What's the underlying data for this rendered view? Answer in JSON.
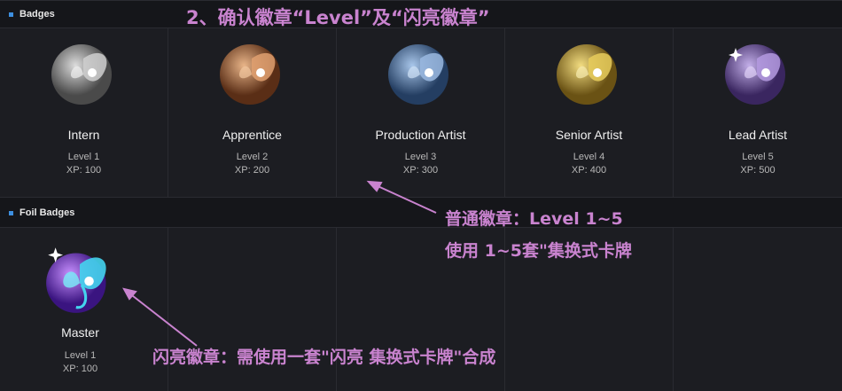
{
  "sections": {
    "badges_title": "Badges",
    "foil_title": "Foil Badges"
  },
  "badges": [
    {
      "name": "Intern",
      "level": "Level 1",
      "xp": "XP: 100",
      "color": "#a8a8a8"
    },
    {
      "name": "Apprentice",
      "level": "Level 2",
      "xp": "XP: 200",
      "color": "#c07a4a"
    },
    {
      "name": "Production Artist",
      "level": "Level 3",
      "xp": "XP: 300",
      "color": "#5a84b8"
    },
    {
      "name": "Senior Artist",
      "level": "Level 4",
      "xp": "XP: 400",
      "color": "#c8a63a"
    },
    {
      "name": "Lead Artist",
      "level": "Level 5",
      "xp": "XP: 500",
      "color": "#7a5aa8"
    }
  ],
  "foil_badges": [
    {
      "name": "Master",
      "level": "Level 1",
      "xp": "XP: 100",
      "color": "#8a4ae0",
      "wing": "#44d4ee"
    }
  ],
  "annotations": {
    "header": "2、确认徽章“Level”及“闪亮徽章”",
    "normal_line1": "普通徽章：Level 1~5",
    "normal_line2": "使用 1~5套\"集换式卡牌",
    "foil": "闪亮徽章：需使用一套\"闪亮 集换式卡牌\"合成"
  }
}
